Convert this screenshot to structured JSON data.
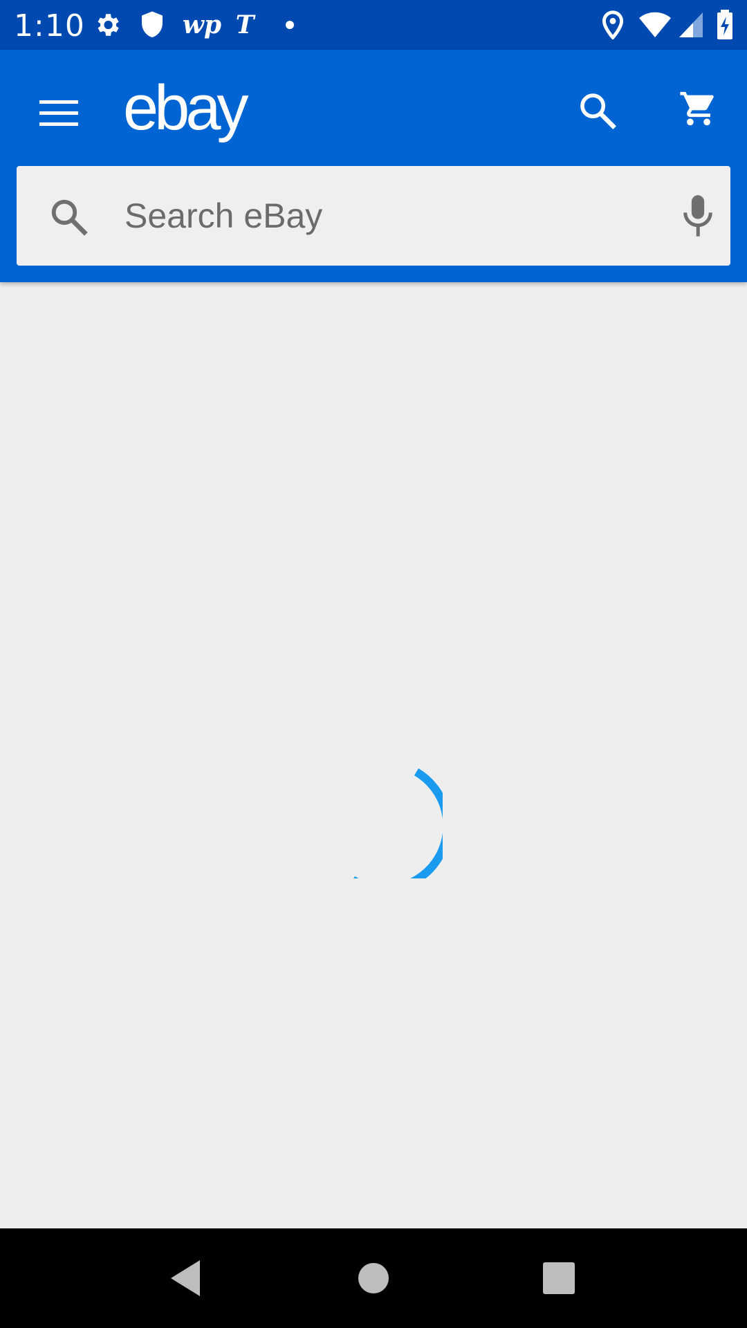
{
  "status_bar": {
    "time": "1:10",
    "left_icons": [
      "gear-icon",
      "shield-icon",
      "washington-post-icon",
      "nyt-icon",
      "dot-icon"
    ],
    "wp_text": "wp",
    "nyt_text": "T",
    "right_icons": [
      "location-icon",
      "wifi-icon",
      "signal-icon",
      "battery-charging-icon"
    ]
  },
  "app_bar": {
    "logo_text": "ebay",
    "menu_icon": "hamburger-menu-icon",
    "search_icon": "search-icon",
    "cart_icon": "cart-icon",
    "background_color": "#0065d3"
  },
  "search": {
    "placeholder": "Search eBay",
    "value": "",
    "mic_icon": "microphone-icon"
  },
  "content": {
    "state": "loading",
    "spinner_color": "#1a9bf0",
    "background_color": "#eeeeee"
  },
  "nav_bar": {
    "buttons": [
      "back-icon",
      "home-icon",
      "recents-icon"
    ]
  }
}
